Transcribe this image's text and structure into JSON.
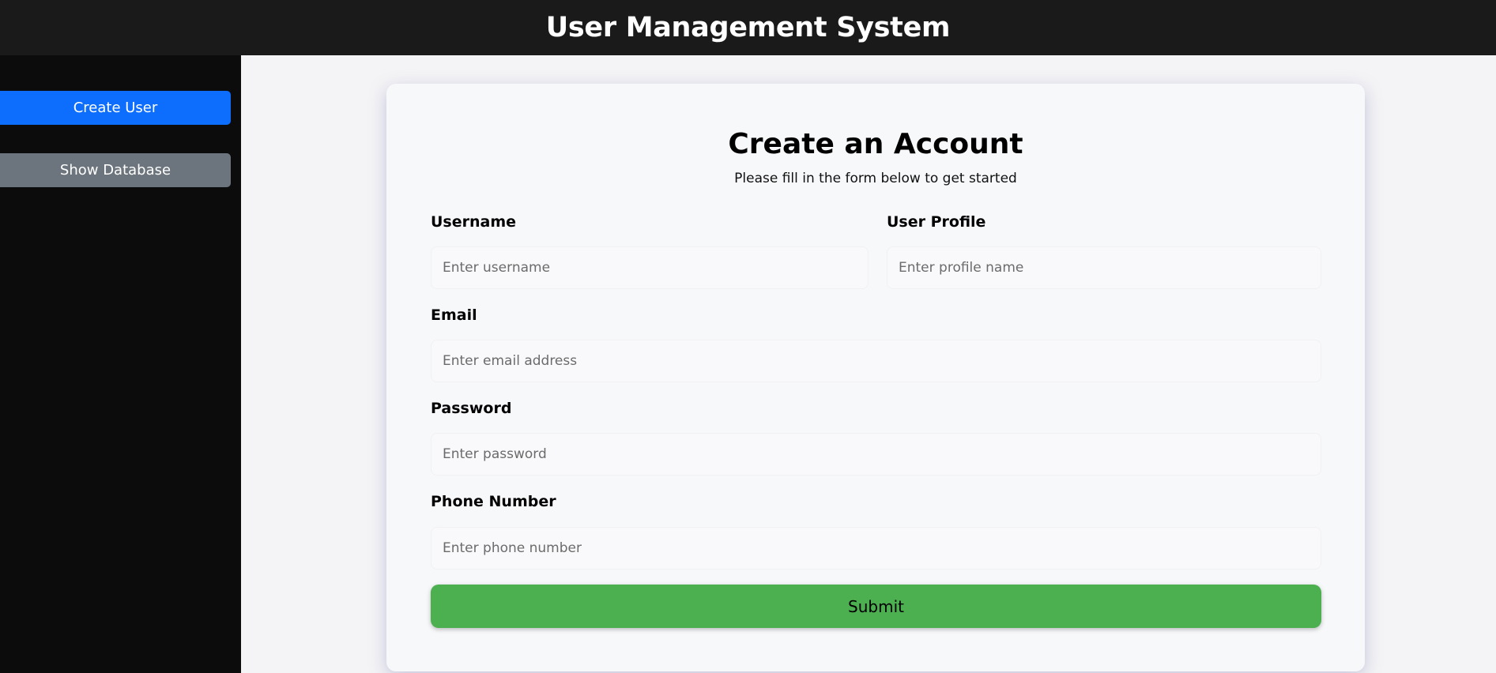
{
  "header": {
    "title": "User Management System"
  },
  "sidebar": {
    "buttons": [
      {
        "label": "Create User",
        "color": "#0d6efd"
      },
      {
        "label": "Show Database",
        "color": "#6c757d"
      }
    ]
  },
  "form": {
    "title": "Create an Account",
    "subtitle": "Please fill in the form below to get started",
    "fields": {
      "username": {
        "label": "Username",
        "placeholder": "Enter username",
        "value": ""
      },
      "profile": {
        "label": "User Profile",
        "placeholder": "Enter profile name",
        "value": ""
      },
      "email": {
        "label": "Email",
        "placeholder": "Enter email address",
        "value": ""
      },
      "password": {
        "label": "Password",
        "placeholder": "Enter password",
        "value": ""
      },
      "phone": {
        "label": "Phone Number",
        "placeholder": "Enter phone number",
        "value": ""
      }
    },
    "submit_label": "Submit",
    "submit_color": "#4caf50"
  }
}
